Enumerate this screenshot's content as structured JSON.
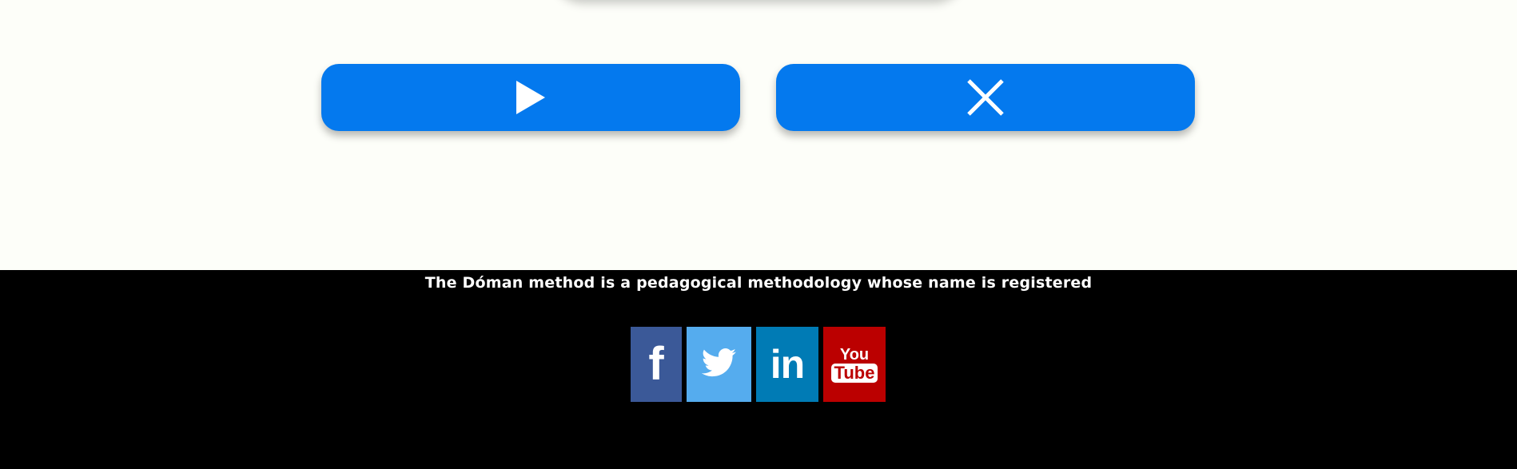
{
  "controls": {
    "play_icon": "play-icon",
    "close_icon": "close-icon",
    "button_color": "#0479ee"
  },
  "footer": {
    "text": "The Dóman method is a pedagogical methodology whose name is registered",
    "social": [
      {
        "name": "facebook",
        "glyph": "f",
        "color": "#3b5998"
      },
      {
        "name": "twitter",
        "icon": "twitter-bird-icon",
        "color": "#55acee"
      },
      {
        "name": "linkedin",
        "glyph": "in",
        "color": "#007bb5"
      },
      {
        "name": "youtube",
        "glyph_top": "You",
        "glyph_bottom": "Tube",
        "color": "#bb0000"
      }
    ]
  }
}
